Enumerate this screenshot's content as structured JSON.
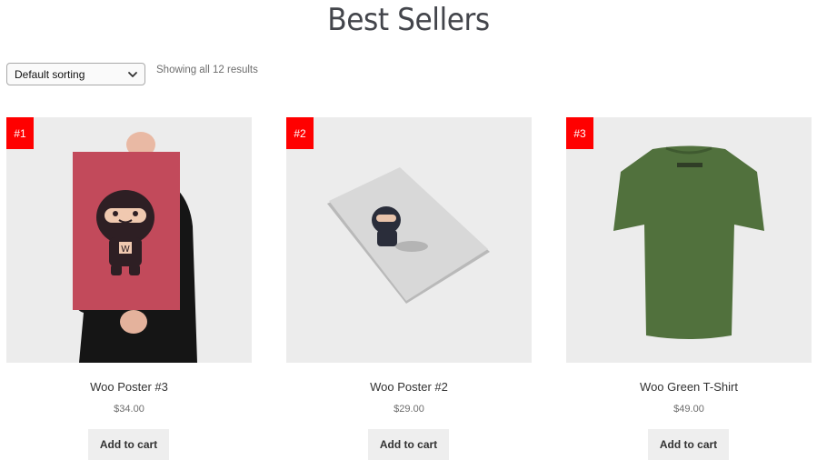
{
  "page": {
    "title": "Best Sellers"
  },
  "toolbar": {
    "sorting_selected": "Default sorting",
    "result_count": "Showing all 12 results"
  },
  "products": [
    {
      "rank": "#1",
      "name": "Woo Poster #3",
      "price": "$34.00",
      "button": "Add to cart"
    },
    {
      "rank": "#2",
      "name": "Woo Poster #2",
      "price": "$29.00",
      "button": "Add to cart"
    },
    {
      "rank": "#3",
      "name": "Woo Green T-Shirt",
      "price": "$49.00",
      "button": "Add to cart"
    }
  ],
  "colors": {
    "rank_badge": "#ff0000",
    "image_bg": "#ececec",
    "button_bg": "#eeeeee"
  }
}
